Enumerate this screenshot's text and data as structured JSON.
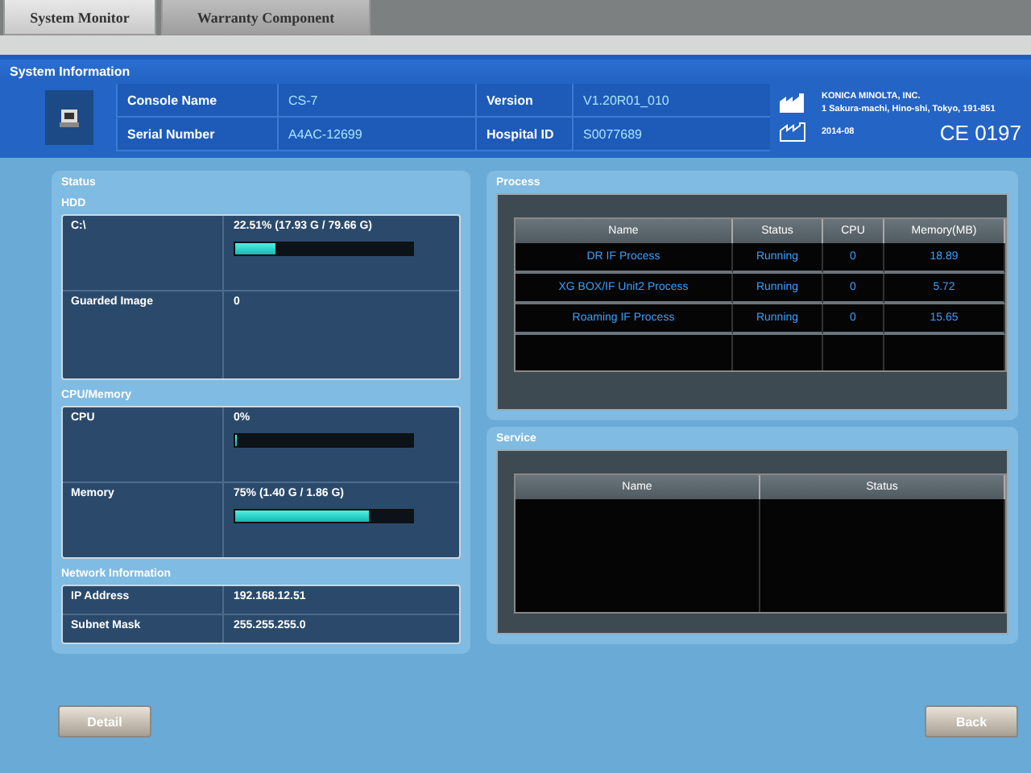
{
  "tabs": [
    {
      "label": "System Monitor",
      "selected": true
    },
    {
      "label": "Warranty Component",
      "selected": false
    }
  ],
  "window": {
    "title": "System Information"
  },
  "info": {
    "fields": [
      {
        "label": "Console Name",
        "value": "CS-7"
      },
      {
        "label": "Version",
        "value": "V1.20R01_010"
      },
      {
        "label": "Serial Number",
        "value": "A4AC-12699"
      },
      {
        "label": "Hospital ID",
        "value": "S0077689"
      }
    ],
    "manufacturer": "KONICA MINOLTA, INC.",
    "address": "1 Sakura-machi, Hino-shi, Tokyo, 191-851",
    "date": "2014-08",
    "ce_mark": "CE 0197"
  },
  "status": {
    "title": "Status",
    "hdd": {
      "title": "HDD",
      "rows": [
        {
          "kind": "meter",
          "label": "C:\\",
          "reading": "22.51% (17.93 G / 79.66 G)",
          "level": 0.2251
        },
        {
          "kind": "text",
          "label": "Guarded Image",
          "reading": "0"
        }
      ]
    },
    "cpu_memory": {
      "title": "CPU/Memory",
      "rows": [
        {
          "kind": "meter",
          "label": "CPU",
          "reading": "0%",
          "level": 0
        },
        {
          "kind": "meter",
          "label": "Memory",
          "reading": "75% (1.40 G / 1.86 G)",
          "level": 0.75
        }
      ]
    },
    "network": {
      "title": "Network Information",
      "rows": [
        {
          "label": "IP Address",
          "value": "192.168.12.51"
        },
        {
          "label": "Subnet Mask",
          "value": "255.255.255.0"
        }
      ]
    }
  },
  "process": {
    "title": "Process",
    "columns": [
      "Name",
      "Status",
      "CPU",
      "Memory(MB)"
    ],
    "rows": [
      [
        "DR IF Process",
        "Running",
        "0",
        "18.89"
      ],
      [
        "XG BOX/IF Unit2 Process",
        "Running",
        "0",
        "5.72"
      ],
      [
        "Roaming IF Process",
        "Running",
        "0",
        "15.65"
      ]
    ]
  },
  "service": {
    "title": "Service",
    "columns": [
      "Name",
      "Status"
    ]
  },
  "buttons": {
    "left": "Detail",
    "right": "Back"
  }
}
